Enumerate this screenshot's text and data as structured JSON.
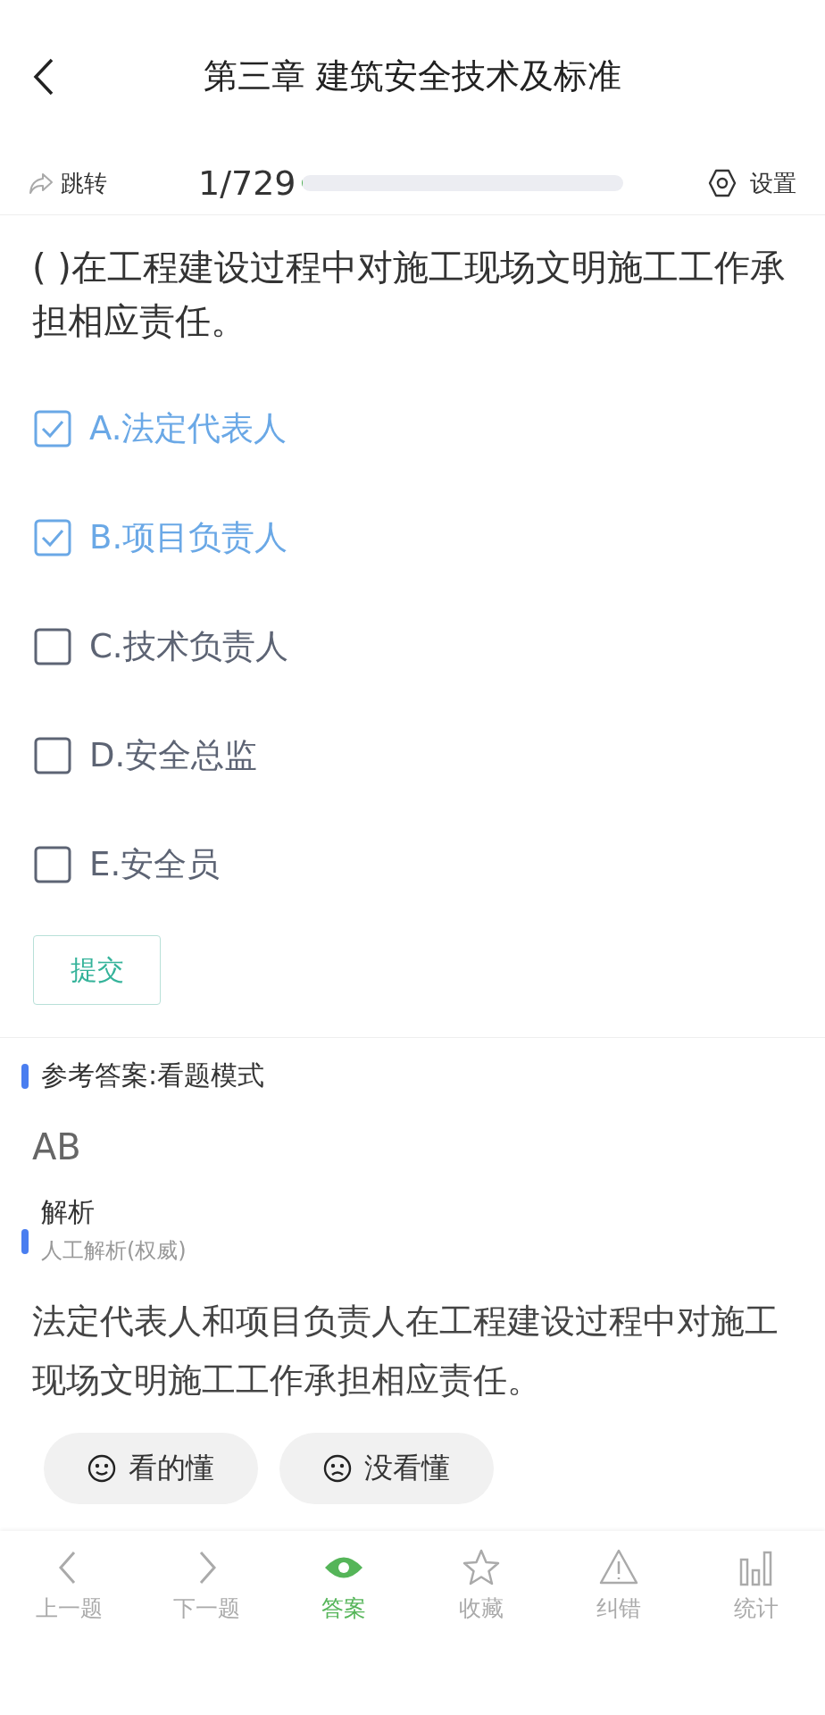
{
  "header": {
    "title": "第三章 建筑安全技术及标准"
  },
  "toolbar": {
    "jump": "跳转",
    "progress_text": "1/729",
    "progress": {
      "level": 0.0014
    },
    "settings": "设置"
  },
  "question": {
    "text": "( )在工程建设过程中对施工现场文明施工工作承担相应责任。",
    "options": [
      {
        "label": "A.法定代表人",
        "checked": true
      },
      {
        "label": "B.项目负责人",
        "checked": true
      },
      {
        "label": "C.技术负责人",
        "checked": false
      },
      {
        "label": "D.安全总监",
        "checked": false
      },
      {
        "label": "E.安全员",
        "checked": false
      }
    ],
    "submit": "提交"
  },
  "answer": {
    "heading": "参考答案:看题模式",
    "value": "AB"
  },
  "analysis": {
    "heading": "解析",
    "subtitle": "人工解析(权威)",
    "text": "法定代表人和项目负责人在工程建设过程中对施工现场文明施工工作承担相应责任。",
    "feedback": [
      {
        "kind": "happy",
        "label": "看的懂"
      },
      {
        "kind": "sad",
        "label": "没看懂"
      }
    ]
  },
  "tabbar": [
    {
      "kind": "prev",
      "label": "上一题",
      "selected": false
    },
    {
      "kind": "next",
      "label": "下一题",
      "selected": false
    },
    {
      "kind": "eye",
      "label": "答案",
      "selected": true
    },
    {
      "kind": "star",
      "label": "收藏",
      "selected": false
    },
    {
      "kind": "warn",
      "label": "纠错",
      "selected": false
    },
    {
      "kind": "stats",
      "label": "统计",
      "selected": false
    }
  ]
}
